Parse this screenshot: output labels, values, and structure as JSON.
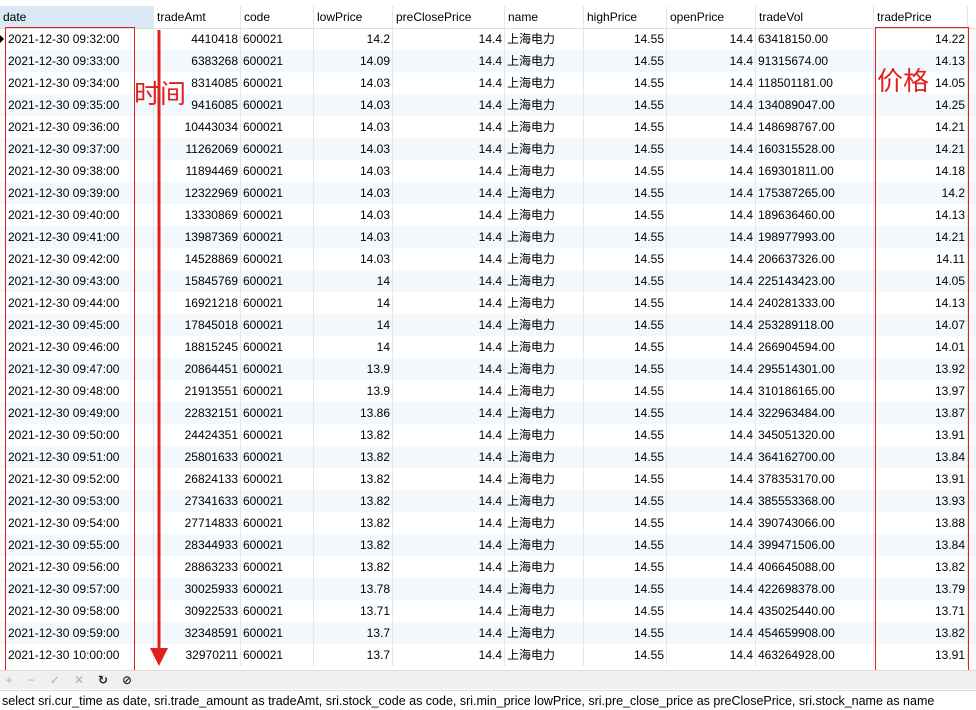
{
  "grid": {
    "columns": [
      {
        "key": "date",
        "label": "date",
        "align": "l"
      },
      {
        "key": "tradeAmt",
        "label": "tradeAmt",
        "align": "r"
      },
      {
        "key": "code",
        "label": "code",
        "align": "l"
      },
      {
        "key": "lowPrice",
        "label": "lowPrice",
        "align": "r"
      },
      {
        "key": "preClosePrice",
        "label": "preClosePrice",
        "align": "r"
      },
      {
        "key": "name",
        "label": "name",
        "align": "l"
      },
      {
        "key": "highPrice",
        "label": "highPrice",
        "align": "r"
      },
      {
        "key": "openPrice",
        "label": "openPrice",
        "align": "r"
      },
      {
        "key": "tradeVol",
        "label": "tradeVol",
        "align": "l"
      },
      {
        "key": "tradePrice",
        "label": "tradePrice",
        "align": "r"
      }
    ],
    "rows": [
      [
        "2021-12-30 09:32:00",
        "4410418",
        "600021",
        "14.2",
        "14.4",
        "上海电力",
        "14.55",
        "14.4",
        "63418150.00",
        "14.22"
      ],
      [
        "2021-12-30 09:33:00",
        "6383268",
        "600021",
        "14.09",
        "14.4",
        "上海电力",
        "14.55",
        "14.4",
        "91315674.00",
        "14.13"
      ],
      [
        "2021-12-30 09:34:00",
        "8314085",
        "600021",
        "14.03",
        "14.4",
        "上海电力",
        "14.55",
        "14.4",
        "118501181.00",
        "14.05"
      ],
      [
        "2021-12-30 09:35:00",
        "9416085",
        "600021",
        "14.03",
        "14.4",
        "上海电力",
        "14.55",
        "14.4",
        "134089047.00",
        "14.25"
      ],
      [
        "2021-12-30 09:36:00",
        "10443034",
        "600021",
        "14.03",
        "14.4",
        "上海电力",
        "14.55",
        "14.4",
        "148698767.00",
        "14.21"
      ],
      [
        "2021-12-30 09:37:00",
        "11262069",
        "600021",
        "14.03",
        "14.4",
        "上海电力",
        "14.55",
        "14.4",
        "160315528.00",
        "14.21"
      ],
      [
        "2021-12-30 09:38:00",
        "11894469",
        "600021",
        "14.03",
        "14.4",
        "上海电力",
        "14.55",
        "14.4",
        "169301811.00",
        "14.18"
      ],
      [
        "2021-12-30 09:39:00",
        "12322969",
        "600021",
        "14.03",
        "14.4",
        "上海电力",
        "14.55",
        "14.4",
        "175387265.00",
        "14.2"
      ],
      [
        "2021-12-30 09:40:00",
        "13330869",
        "600021",
        "14.03",
        "14.4",
        "上海电力",
        "14.55",
        "14.4",
        "189636460.00",
        "14.13"
      ],
      [
        "2021-12-30 09:41:00",
        "13987369",
        "600021",
        "14.03",
        "14.4",
        "上海电力",
        "14.55",
        "14.4",
        "198977993.00",
        "14.21"
      ],
      [
        "2021-12-30 09:42:00",
        "14528869",
        "600021",
        "14.03",
        "14.4",
        "上海电力",
        "14.55",
        "14.4",
        "206637326.00",
        "14.11"
      ],
      [
        "2021-12-30 09:43:00",
        "15845769",
        "600021",
        "14",
        "14.4",
        "上海电力",
        "14.55",
        "14.4",
        "225143423.00",
        "14.05"
      ],
      [
        "2021-12-30 09:44:00",
        "16921218",
        "600021",
        "14",
        "14.4",
        "上海电力",
        "14.55",
        "14.4",
        "240281333.00",
        "14.13"
      ],
      [
        "2021-12-30 09:45:00",
        "17845018",
        "600021",
        "14",
        "14.4",
        "上海电力",
        "14.55",
        "14.4",
        "253289118.00",
        "14.07"
      ],
      [
        "2021-12-30 09:46:00",
        "18815245",
        "600021",
        "14",
        "14.4",
        "上海电力",
        "14.55",
        "14.4",
        "266904594.00",
        "14.01"
      ],
      [
        "2021-12-30 09:47:00",
        "20864451",
        "600021",
        "13.9",
        "14.4",
        "上海电力",
        "14.55",
        "14.4",
        "295514301.00",
        "13.92"
      ],
      [
        "2021-12-30 09:48:00",
        "21913551",
        "600021",
        "13.9",
        "14.4",
        "上海电力",
        "14.55",
        "14.4",
        "310186165.00",
        "13.97"
      ],
      [
        "2021-12-30 09:49:00",
        "22832151",
        "600021",
        "13.86",
        "14.4",
        "上海电力",
        "14.55",
        "14.4",
        "322963484.00",
        "13.87"
      ],
      [
        "2021-12-30 09:50:00",
        "24424351",
        "600021",
        "13.82",
        "14.4",
        "上海电力",
        "14.55",
        "14.4",
        "345051320.00",
        "13.91"
      ],
      [
        "2021-12-30 09:51:00",
        "25801633",
        "600021",
        "13.82",
        "14.4",
        "上海电力",
        "14.55",
        "14.4",
        "364162700.00",
        "13.84"
      ],
      [
        "2021-12-30 09:52:00",
        "26824133",
        "600021",
        "13.82",
        "14.4",
        "上海电力",
        "14.55",
        "14.4",
        "378353170.00",
        "13.91"
      ],
      [
        "2021-12-30 09:53:00",
        "27341633",
        "600021",
        "13.82",
        "14.4",
        "上海电力",
        "14.55",
        "14.4",
        "385553368.00",
        "13.93"
      ],
      [
        "2021-12-30 09:54:00",
        "27714833",
        "600021",
        "13.82",
        "14.4",
        "上海电力",
        "14.55",
        "14.4",
        "390743066.00",
        "13.88"
      ],
      [
        "2021-12-30 09:55:00",
        "28344933",
        "600021",
        "13.82",
        "14.4",
        "上海电力",
        "14.55",
        "14.4",
        "399471506.00",
        "13.84"
      ],
      [
        "2021-12-30 09:56:00",
        "28863233",
        "600021",
        "13.82",
        "14.4",
        "上海电力",
        "14.55",
        "14.4",
        "406645088.00",
        "13.82"
      ],
      [
        "2021-12-30 09:57:00",
        "30025933",
        "600021",
        "13.78",
        "14.4",
        "上海电力",
        "14.55",
        "14.4",
        "422698378.00",
        "13.79"
      ],
      [
        "2021-12-30 09:58:00",
        "30922533",
        "600021",
        "13.71",
        "14.4",
        "上海电力",
        "14.55",
        "14.4",
        "435025440.00",
        "13.71"
      ],
      [
        "2021-12-30 09:59:00",
        "32348591",
        "600021",
        "13.7",
        "14.4",
        "上海电力",
        "14.55",
        "14.4",
        "454659908.00",
        "13.82"
      ],
      [
        "2021-12-30 10:00:00",
        "32970211",
        "600021",
        "13.7",
        "14.4",
        "上海电力",
        "14.55",
        "14.4",
        "463264928.00",
        "13.91"
      ]
    ]
  },
  "annotations": {
    "time_label": "时间",
    "price_label": "价格",
    "color": "#e02020"
  },
  "toolbar": {
    "buttons": [
      {
        "name": "add-record-icon",
        "glyph": "+",
        "active": false
      },
      {
        "name": "delete-record-icon",
        "glyph": "−",
        "active": false
      },
      {
        "name": "apply-changes-icon",
        "glyph": "✓",
        "active": false
      },
      {
        "name": "discard-changes-icon",
        "glyph": "✕",
        "active": false
      },
      {
        "name": "refresh-icon",
        "glyph": "↻",
        "active": true
      },
      {
        "name": "stop-icon",
        "glyph": "⊘",
        "active": true
      }
    ]
  },
  "sql_bar": {
    "text": "select  sri.cur_time as date,  sri.trade_amount as tradeAmt,  sri.stock_code as code,  sri.min_price lowPrice,  sri.pre_close_price as preClosePrice,  sri.stock_name as name"
  }
}
